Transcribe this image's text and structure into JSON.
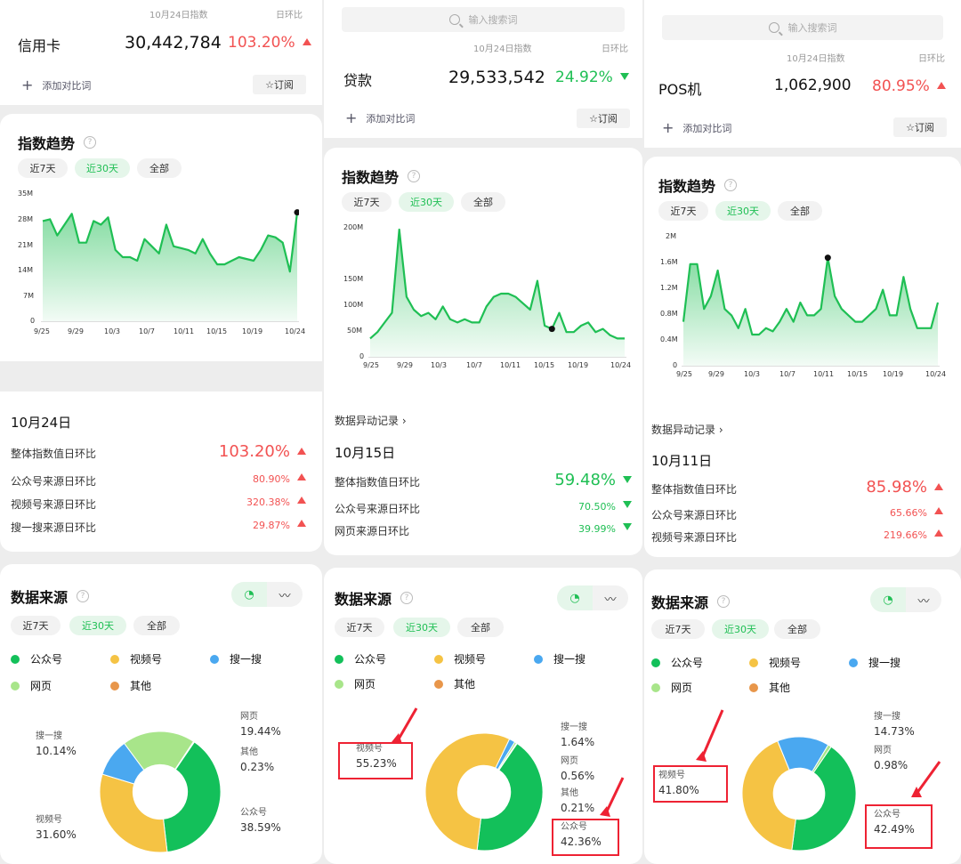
{
  "colors": {
    "green": "#1fbf54",
    "red": "#f25252",
    "wechat": "#13c05a",
    "video": "#f5c344",
    "search": "#4aa8f0",
    "web": "#a8e58a",
    "other": "#e8964a"
  },
  "panel1": {
    "date_header": "10月24日指数",
    "ratio_header": "日环比",
    "keyword": "信用卡",
    "index_value": "30,442,784",
    "change": "103.20%",
    "add_compare": "添加对比词",
    "subscribe": "订阅",
    "trend_title": "指数趋势",
    "tabs": [
      "近7天",
      "近30天",
      "全部"
    ],
    "chart_data": {
      "type": "area",
      "x": [
        "9/25",
        "9/29",
        "10/3",
        "10/7",
        "10/11",
        "10/15",
        "10/19",
        "10/24"
      ],
      "y_ticks": [
        "35M",
        "28M",
        "21M",
        "14M",
        "7M",
        "0"
      ],
      "ylim": [
        0,
        35000000
      ],
      "values": [
        28,
        28.5,
        24,
        27,
        30,
        22,
        22,
        28,
        27,
        29,
        20,
        18,
        18,
        17,
        23,
        21,
        19,
        27,
        21,
        20.5,
        20,
        19,
        23,
        19,
        16,
        16,
        17,
        18,
        17.5,
        17,
        20,
        24,
        23.5,
        22,
        14,
        30.4
      ]
    },
    "record_date": "10月24日",
    "records": [
      {
        "label": "整体指数值日环比",
        "value": "103.20%"
      },
      {
        "label": "公众号来源日环比",
        "value": "80.90%"
      },
      {
        "label": "视频号来源日环比",
        "value": "320.38%"
      },
      {
        "label": "搜一搜来源日环比",
        "value": "29.87%"
      }
    ],
    "source_title": "数据来源",
    "source_tabs": [
      "近7天",
      "近30天",
      "全部"
    ],
    "legend": [
      "公众号",
      "视频号",
      "搜一搜",
      "网页",
      "其他"
    ],
    "donut": {
      "type": "pie",
      "slices": [
        {
          "name": "公众号",
          "value": 38.59
        },
        {
          "name": "视频号",
          "value": 31.6
        },
        {
          "name": "搜一搜",
          "value": 10.14
        },
        {
          "name": "网页",
          "value": 19.44
        },
        {
          "name": "其他",
          "value": 0.23
        }
      ]
    },
    "labels": [
      {
        "name": "网页",
        "value": "19.44%"
      },
      {
        "name": "其他",
        "value": "0.23%"
      },
      {
        "name": "搜一搜",
        "value": "10.14%"
      },
      {
        "name": "视频号",
        "value": "31.60%"
      },
      {
        "name": "公众号",
        "value": "38.59%"
      }
    ]
  },
  "panel2": {
    "search_placeholder": "输入搜索词",
    "date_header": "10月24日指数",
    "ratio_header": "日环比",
    "keyword": "贷款",
    "index_value": "29,533,542",
    "change": "24.92%",
    "add_compare": "添加对比词",
    "subscribe": "订阅",
    "trend_title": "指数趋势",
    "tabs": [
      "近7天",
      "近30天",
      "全部"
    ],
    "chart_data": {
      "type": "area",
      "x": [
        "9/25",
        "9/29",
        "10/3",
        "10/7",
        "10/11",
        "10/15",
        "10/19",
        "10/24"
      ],
      "y_ticks": [
        "200M",
        "150M",
        "100M",
        "50M",
        "0"
      ],
      "ylim": [
        0,
        200000000
      ],
      "values": [
        30,
        40,
        55,
        70,
        200,
        95,
        75,
        65,
        70,
        60,
        80,
        60,
        55,
        60,
        55,
        55,
        80,
        95,
        100,
        100,
        95,
        85,
        75,
        120,
        50,
        45,
        70,
        40,
        40,
        50,
        55,
        40,
        45,
        35,
        30,
        30
      ]
    },
    "record_link": "数据异动记录",
    "record_date": "10月15日",
    "records": [
      {
        "label": "整体指数值日环比",
        "value": "59.48%"
      },
      {
        "label": "公众号来源日环比",
        "value": "70.50%"
      },
      {
        "label": "网页来源日环比",
        "value": "39.99%"
      }
    ],
    "source_title": "数据来源",
    "source_tabs": [
      "近7天",
      "近30天",
      "全部"
    ],
    "legend": [
      "公众号",
      "视频号",
      "搜一搜",
      "网页",
      "其他"
    ],
    "donut": {
      "type": "pie",
      "slices": [
        {
          "name": "公众号",
          "value": 42.36
        },
        {
          "name": "视频号",
          "value": 55.23
        },
        {
          "name": "搜一搜",
          "value": 1.64
        },
        {
          "name": "网页",
          "value": 0.56
        },
        {
          "name": "其他",
          "value": 0.21
        }
      ]
    },
    "labels": [
      {
        "name": "视频号",
        "value": "55.23%"
      },
      {
        "name": "搜一搜",
        "value": "1.64%"
      },
      {
        "name": "网页",
        "value": "0.56%"
      },
      {
        "name": "其他",
        "value": "0.21%"
      },
      {
        "name": "公众号",
        "value": "42.36%"
      }
    ]
  },
  "panel3": {
    "search_placeholder": "输入搜索词",
    "date_header": "10月24日指数",
    "ratio_header": "日环比",
    "keyword": "POS机",
    "index_value": "1,062,900",
    "change": "80.95%",
    "add_compare": "添加对比词",
    "subscribe": "订阅",
    "trend_title": "指数趋势",
    "tabs": [
      "近7天",
      "近30天",
      "全部"
    ],
    "chart_data": {
      "type": "area",
      "x": [
        "9/25",
        "9/29",
        "10/3",
        "10/7",
        "10/11",
        "10/15",
        "10/19",
        "10/24"
      ],
      "y_ticks": [
        "2M",
        "1.6M",
        "1.2M",
        "0.8M",
        "0.4M",
        "0"
      ],
      "ylim": [
        0,
        2000000
      ],
      "values": [
        0.7,
        1.6,
        1.6,
        0.9,
        1.1,
        1.5,
        0.9,
        0.8,
        0.6,
        0.9,
        0.5,
        0.5,
        0.6,
        0.55,
        0.7,
        0.9,
        0.7,
        1.0,
        0.8,
        0.8,
        0.9,
        1.7,
        1.1,
        0.9,
        0.8,
        0.7,
        0.7,
        0.8,
        0.9,
        1.2,
        0.8,
        0.8,
        1.4,
        0.9,
        0.6,
        0.6,
        0.6,
        1.0
      ]
    },
    "record_link": "数据异动记录",
    "record_date": "10月11日",
    "records": [
      {
        "label": "整体指数值日环比",
        "value": "85.98%"
      },
      {
        "label": "公众号来源日环比",
        "value": "65.66%"
      },
      {
        "label": "视频号来源日环比",
        "value": "219.66%"
      }
    ],
    "source_title": "数据来源",
    "source_tabs": [
      "近7天",
      "近30天",
      "全部"
    ],
    "legend": [
      "公众号",
      "视频号",
      "搜一搜",
      "网页",
      "其他"
    ],
    "donut": {
      "type": "pie",
      "slices": [
        {
          "name": "公众号",
          "value": 42.49
        },
        {
          "name": "视频号",
          "value": 41.8
        },
        {
          "name": "搜一搜",
          "value": 14.73
        },
        {
          "name": "网页",
          "value": 0.98
        }
      ]
    },
    "labels": [
      {
        "name": "搜一搜",
        "value": "14.73%"
      },
      {
        "name": "网页",
        "value": "0.98%"
      },
      {
        "name": "视频号",
        "value": "41.80%"
      },
      {
        "name": "公众号",
        "value": "42.49%"
      }
    ]
  }
}
